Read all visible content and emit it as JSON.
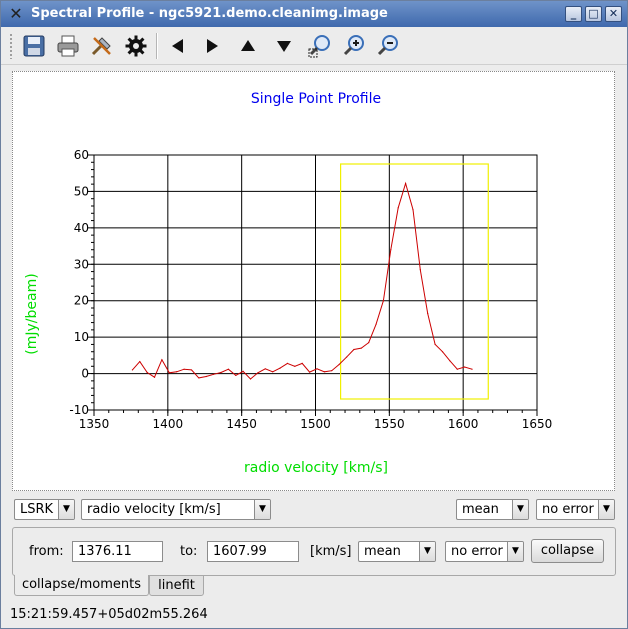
{
  "window": {
    "title": "Spectral Profile - ngc5921.demo.cleanimg.image",
    "app_icon": "casa-x-icon",
    "controls": [
      "minimize",
      "maximize",
      "close"
    ]
  },
  "toolbar": {
    "icons": [
      "save-icon",
      "print-icon",
      "tools-icon",
      "gear-icon",
      "arrow-left-icon",
      "arrow-right-icon",
      "arrow-up-icon",
      "arrow-down-icon",
      "zoom-fit-icon",
      "zoom-in-icon",
      "zoom-out-icon"
    ]
  },
  "plot": {
    "colors": {
      "title": "#0000ee",
      "axis_labels": "#00dd00",
      "curve": "#cc0000",
      "box": "#f0f000"
    }
  },
  "chart_data": {
    "type": "line",
    "title": "Single Point Profile",
    "xlabel": "radio velocity [km/s]",
    "ylabel": "(mJy/beam)",
    "xlim": [
      1350,
      1650
    ],
    "ylim": [
      -10,
      60
    ],
    "xticks": [
      "1350",
      "1400",
      "1450",
      "1500",
      "1550",
      "1600",
      "1650"
    ],
    "yticks": [
      "-10",
      "0",
      "10",
      "20",
      "30",
      "40",
      "50",
      "60"
    ],
    "grid": true,
    "series": [
      {
        "x": [
          1376,
          1381,
          1386,
          1391,
          1396,
          1401,
          1406,
          1411,
          1416,
          1421,
          1426,
          1431,
          1436,
          1441,
          1446,
          1451,
          1456,
          1461,
          1466,
          1471,
          1476,
          1481,
          1486,
          1491,
          1496,
          1501,
          1506,
          1511,
          1516,
          1521,
          1526,
          1531,
          1536,
          1541,
          1546,
          1551,
          1556,
          1561,
          1566,
          1571,
          1576,
          1581,
          1586,
          1591,
          1596,
          1601,
          1606
        ],
        "y": [
          1.0,
          3.3,
          0.3,
          -1.0,
          3.8,
          0.2,
          0.5,
          1.2,
          1.0,
          -1.2,
          -0.8,
          -0.2,
          0.3,
          1.2,
          -0.5,
          0.6,
          -1.5,
          0.2,
          1.3,
          0.5,
          1.5,
          2.8,
          2.0,
          2.8,
          0.4,
          1.3,
          0.5,
          0.8,
          2.5,
          4.5,
          6.6,
          7.0,
          8.5,
          13.5,
          20.0,
          34.0,
          45.5,
          52.2,
          45.0,
          28.5,
          16.5,
          8.0,
          6.0,
          3.5,
          1.2,
          1.8,
          1.2
        ]
      }
    ],
    "selection_box_x": [
      1517,
      1617
    ]
  },
  "controls": {
    "frame": "LSRK",
    "axis_type": "radio velocity [km/s]",
    "statistic": "mean",
    "error_mode": "no error"
  },
  "collapse": {
    "from_label": "from:",
    "from_value": "1376.11",
    "to_label": "to:",
    "to_value": "1607.99",
    "unit_label": "[km/s]",
    "method": "mean",
    "error": "no error",
    "collapse_button": "collapse"
  },
  "tabs": [
    "collapse/moments",
    "linefit"
  ],
  "status_bar": "15:21:59.457+05d02m55.264"
}
